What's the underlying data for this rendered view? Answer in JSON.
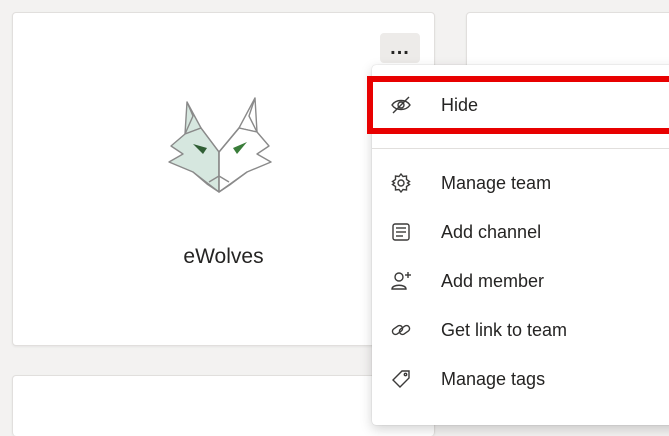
{
  "team": {
    "name": "eWolves",
    "more_label": "..."
  },
  "menu": {
    "items": [
      {
        "label": "Hide",
        "icon": "hide-icon"
      },
      {
        "label": "Manage team",
        "icon": "gear-icon"
      },
      {
        "label": "Add channel",
        "icon": "channel-icon"
      },
      {
        "label": "Add member",
        "icon": "add-person-icon"
      },
      {
        "label": "Get link to team",
        "icon": "link-icon"
      },
      {
        "label": "Manage tags",
        "icon": "tag-icon"
      }
    ]
  },
  "colors": {
    "highlight": "#e80000",
    "logo_fill": "#d6e7df",
    "logo_eye": "#3a7d3a"
  }
}
